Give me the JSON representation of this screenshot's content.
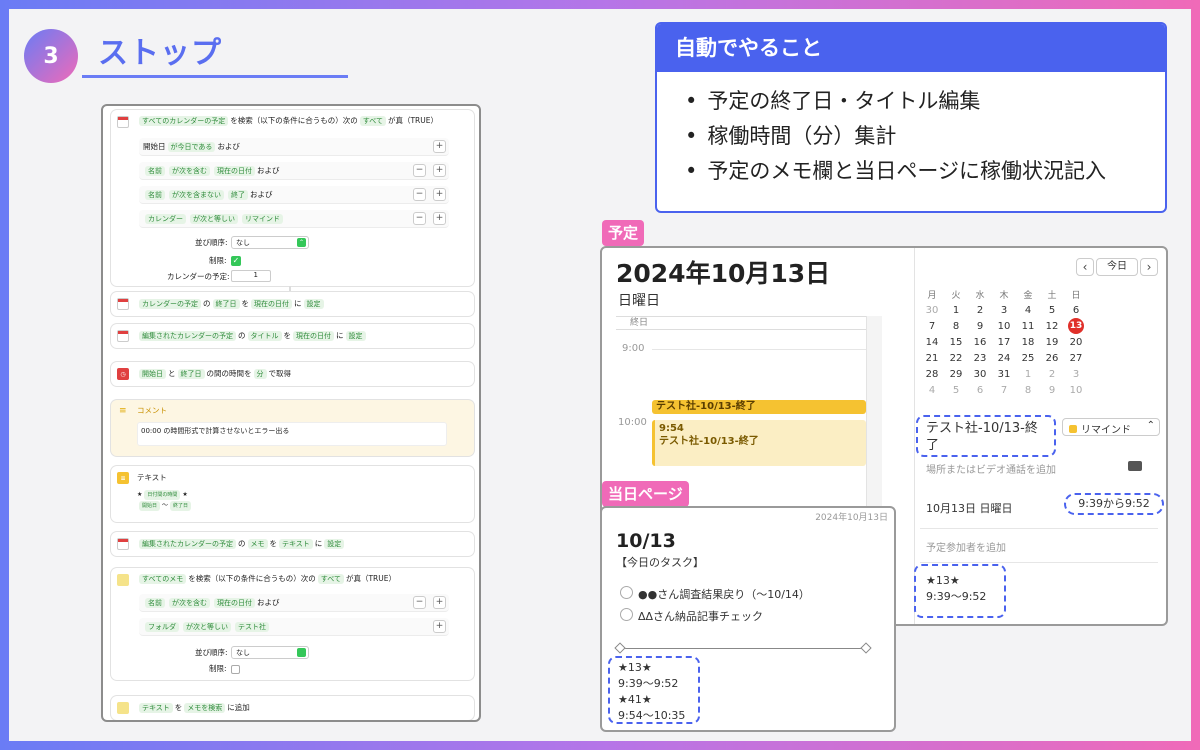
{
  "step": {
    "number": "3",
    "title": "ストップ"
  },
  "shortcuts": {
    "find_events": {
      "pre": "すべてのカレンダーの予定",
      "mid": "を検索（以下の条件に合うもの）次の",
      "all": "すべて",
      "post": "が真（TRUE）"
    },
    "cond1": {
      "a": "開始日",
      "b": "が今日である",
      "c": "および"
    },
    "cond2": {
      "a": "名前",
      "b": "が次を含む",
      "c": "現在の日付",
      "d": "および"
    },
    "cond3": {
      "a": "名前",
      "b": "が次を含まない",
      "c": "終了",
      "d": "および"
    },
    "cond4": {
      "a": "カレンダー",
      "b": "が次と等しい",
      "c": "リマインド"
    },
    "sort_label": "並び順序:",
    "sort_value": "なし",
    "limit_label": "制限:",
    "count_label": "カレンダーの予定:",
    "count_value": "1",
    "set1": {
      "a": "カレンダーの予定",
      "b": "の",
      "c": "終了日",
      "d": "を",
      "e": "現在の日付",
      "f": "に",
      "g": "設定"
    },
    "set2": {
      "a": "編集されたカレンダーの予定",
      "b": "の",
      "c": "タイトル",
      "d": "を",
      "e": "現在の日付",
      "f": "に",
      "g": "設定"
    },
    "diff": {
      "a": "開始日",
      "b": "と",
      "c": "終了日",
      "d": "の間の時間を",
      "e": "分",
      "f": "で取得"
    },
    "comment_label": "コメント",
    "comment_text": "00:00 の時間形式で計算させないとエラー出る",
    "text_label": "テキスト",
    "text_line1a": "★",
    "text_line1b": "日付間の時間",
    "text_line1c": "★",
    "text_line2a": "開始日",
    "text_line2b": "〜",
    "text_line2c": "終了日",
    "set3": {
      "a": "編集されたカレンダーの予定",
      "b": "の",
      "c": "メモ",
      "d": "を",
      "e": "テキスト",
      "f": "に",
      "g": "設定"
    },
    "find_notes": {
      "pre": "すべてのメモ",
      "mid": "を検索（以下の条件に合うもの）次の",
      "all": "すべて",
      "post": "が真（TRUE）"
    },
    "ncond1": {
      "a": "名前",
      "b": "が次を含む",
      "c": "現在の日付",
      "d": "および"
    },
    "ncond2": {
      "a": "フォルダ",
      "b": "が次と等しい",
      "c": "テスト社"
    },
    "nsort_label": "並び順序:",
    "nsort_value": "なし",
    "nlimit_label": "制限:",
    "append": {
      "a": "テキスト",
      "b": "を",
      "c": "メモを検索",
      "d": "に追加"
    }
  },
  "auto": {
    "title": "自動でやること",
    "items": [
      "予定の終了日・タイトル編集",
      "稼働時間（分）集計",
      "予定のメモ欄と当日ページに稼働状況記入"
    ]
  },
  "labels": {
    "schedule": "予定",
    "today_page": "当日ページ"
  },
  "calendar": {
    "date_title": "2024年10月13日",
    "weekday": "日曜日",
    "allday": "終日",
    "hour9": "9:00",
    "hour10": "10:00",
    "event_allday": "テスト社-10/13-終了",
    "event_time": "9:54",
    "event_title": "テスト社-10/13-終了",
    "today_btn": "今日",
    "dow": [
      "月",
      "火",
      "水",
      "木",
      "金",
      "土",
      "日"
    ],
    "weeks": [
      [
        "30",
        "1",
        "2",
        "3",
        "4",
        "5",
        "6"
      ],
      [
        "7",
        "8",
        "9",
        "10",
        "11",
        "12",
        "13"
      ],
      [
        "14",
        "15",
        "16",
        "17",
        "18",
        "19",
        "20"
      ],
      [
        "21",
        "22",
        "23",
        "24",
        "25",
        "26",
        "27"
      ],
      [
        "28",
        "29",
        "30",
        "31",
        "1",
        "2",
        "3"
      ],
      [
        "4",
        "5",
        "6",
        "7",
        "8",
        "9",
        "10"
      ]
    ],
    "selected_day": "13",
    "detail_title": "テスト社-10/13-終了",
    "detail_calendar": "リマインド",
    "location_placeholder": "場所またはビデオ通話を追加",
    "detail_date": "10月13日 日曜日",
    "detail_time": "9:39から9:52",
    "invitees_placeholder": "予定参加者を追加",
    "note_line1": "★13★",
    "note_line2": "9:39〜9:52"
  },
  "today": {
    "date_small": "2024年10月13日",
    "title": "10/13",
    "subtitle": "【今日のタスク】",
    "tasks": [
      "●●さん調査結果戻り（〜10/14）",
      "ΔΔさん納品記事チェック"
    ],
    "log": [
      "★13★",
      "9:39〜9:52",
      "★41★",
      "9:54〜10:35"
    ]
  },
  "colors": {
    "accent": "#4a62ee",
    "pink": "#f06ab8",
    "event_yellow": "#f5c231"
  }
}
